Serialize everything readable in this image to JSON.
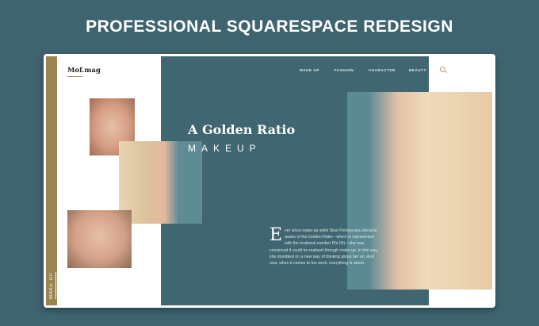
{
  "headline": "PROFESSIONAL SQUARESPACE REDESIGN",
  "site": {
    "logo": "Mof.mag",
    "nav": [
      "MAKE UP",
      "FASHION",
      "CHARACTER",
      "BEAUTY"
    ],
    "search_icon": "search-icon",
    "vertical_label": "MAKE UP",
    "hero": {
      "title": "A Golden Ratio",
      "subtitle": "MAKEUP"
    },
    "article": {
      "dropcap": "E",
      "text": "ver since make-up artist Sissi Petropoulou became aware of the Golden Ratio—which is represented with the irrational number Phi (Φ)—she was convinced it could be realized through make-up. In this way, she stumbled on a new way of thinking about her art. And now, when it comes to her work, everything is about."
    }
  },
  "colors": {
    "background": "#3e6470",
    "panel": "#3f6671",
    "gold": "#9a8550"
  }
}
